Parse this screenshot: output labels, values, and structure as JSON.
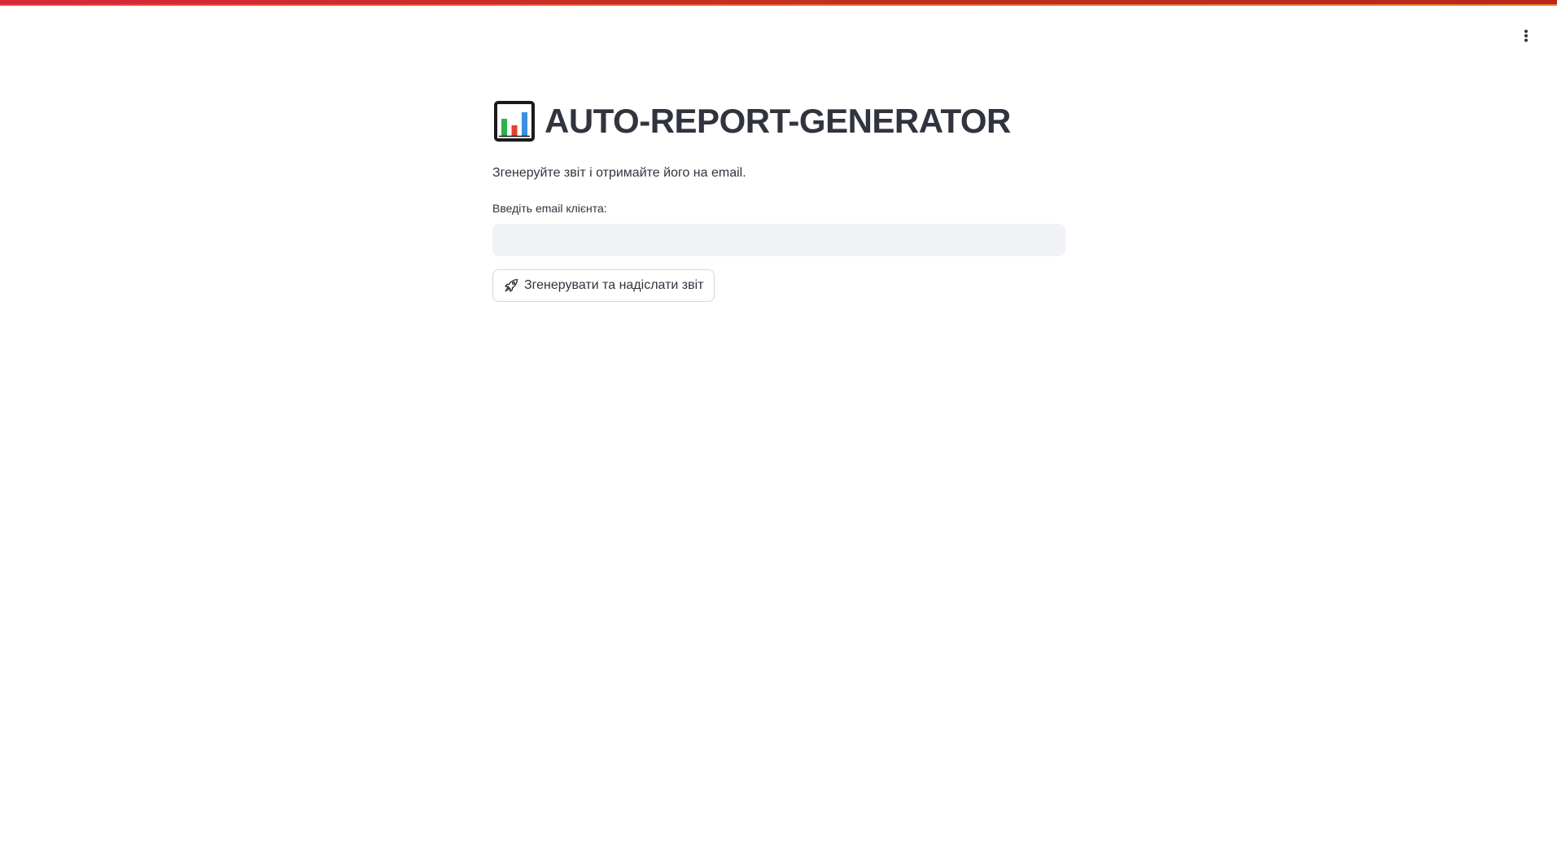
{
  "header": {
    "accent_gradient": [
      "#d62839",
      "#b8261c"
    ],
    "menu_icon": "vertical-ellipsis-icon"
  },
  "main": {
    "title_icon": "bar-chart-icon",
    "title": "AUTO-REPORT-GENERATOR",
    "subtitle": "Згенеруйте звіт і отримайте його на email.",
    "email_field": {
      "label": "Введіть email клієнта:",
      "value": "",
      "placeholder": ""
    },
    "submit_button": {
      "icon": "rocket-icon",
      "label": "Згенерувати та надіслати звіт"
    }
  },
  "colors": {
    "text": "#31333f",
    "input_background": "#f0f2f6",
    "page_background": "#ffffff"
  }
}
